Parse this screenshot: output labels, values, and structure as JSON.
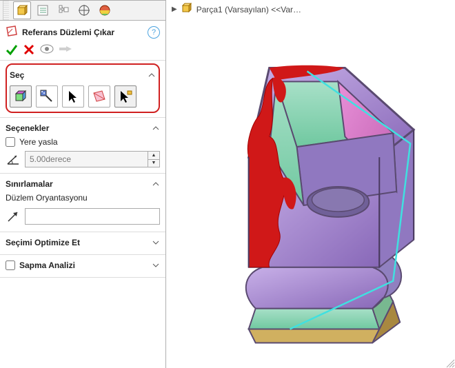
{
  "command": {
    "title": "Referans Düzlemi Çıkar"
  },
  "sections": {
    "sec": {
      "title": "Seç"
    },
    "options": {
      "title": "Seçenekler",
      "snap_to_ground_label": "Yere yasla",
      "snap_to_ground_checked": false,
      "angle_value": "5.00derece"
    },
    "constraints": {
      "title": "Sınırlamalar",
      "plane_orient_label": "Düzlem Oryantasyonu"
    },
    "optimize": {
      "title": "Seçimi Optimize Et"
    },
    "deviation": {
      "title_label": "Sapma Analizi",
      "checked": false
    }
  },
  "tree": {
    "root_label": "Parça1 (Varsayılan) <<Var…"
  },
  "colors": {
    "ok": "#00a000",
    "cancel": "#e00000",
    "highlight_border": "#d02020",
    "edge_cyan": "#40e0e0"
  }
}
